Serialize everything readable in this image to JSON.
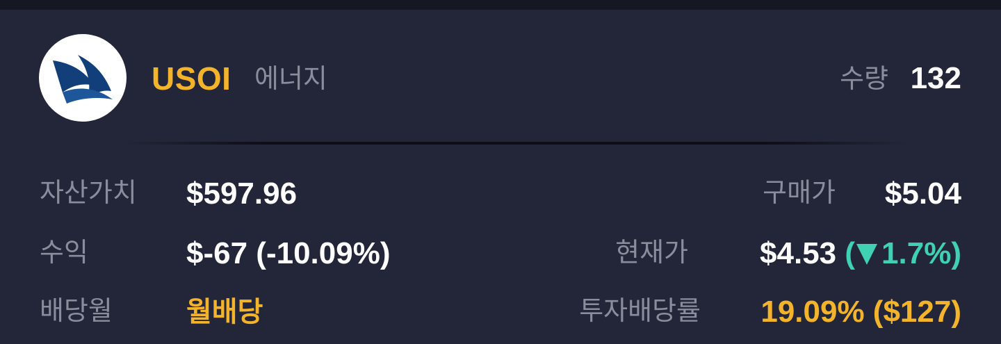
{
  "header": {
    "ticker": "USOI",
    "sector": "에너지",
    "quantity_label": "수량",
    "quantity_value": "132",
    "logo_icon": "sail-logo-icon"
  },
  "left": {
    "asset_value_label": "자산가치",
    "asset_value": "$597.96",
    "profit_label": "수익",
    "profit_value": "$-67 (-10.09%)",
    "dividend_month_label": "배당월",
    "dividend_month_value": "월배당"
  },
  "right": {
    "purchase_price_label": "구매가",
    "purchase_price_value": "$5.04",
    "current_price_label": "현재가",
    "current_price_value": "$4.53",
    "change_open": "(",
    "change_icon": "triangle-down-icon",
    "change_value": "1.7%)",
    "yield_label": "투자배당률",
    "yield_value": "19.09% ($127)"
  },
  "colors": {
    "background": "#232638",
    "accent_gold": "#f3b42b",
    "label_gray": "#8a8d9c",
    "change_teal": "#3fd1b2",
    "logo_blue": "#123f7a"
  }
}
